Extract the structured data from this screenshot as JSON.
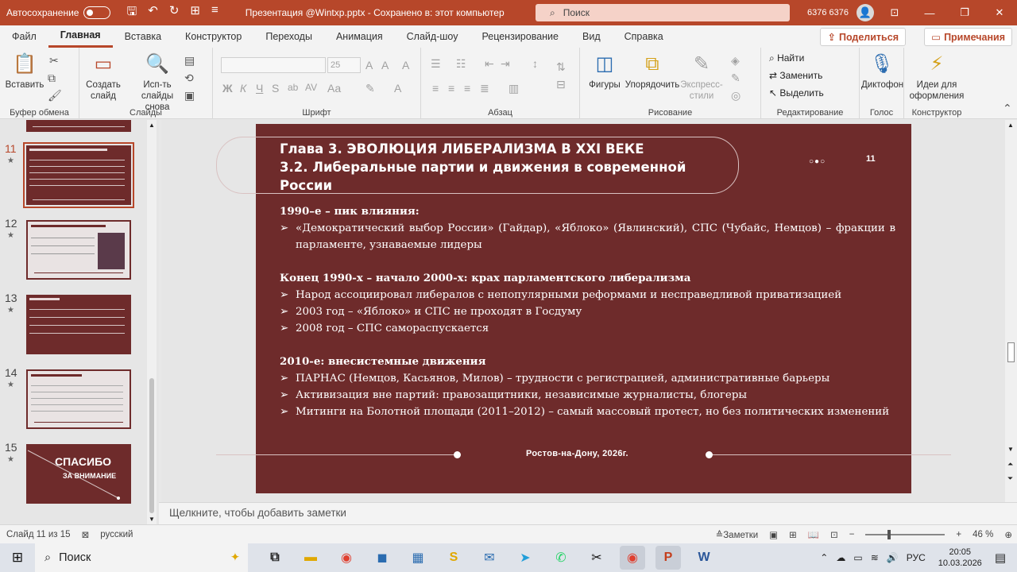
{
  "titlebar": {
    "autosave_label": "Автосохранение",
    "doc_title": "Презентация @Wintxp.pptx  -  Сохранено в: этот компьютер",
    "search_placeholder": "Поиск",
    "user_name": "6376 6376"
  },
  "menu": {
    "tabs": [
      "Файл",
      "Главная",
      "Вставка",
      "Конструктор",
      "Переходы",
      "Анимация",
      "Слайд-шоу",
      "Рецензирование",
      "Вид",
      "Справка"
    ],
    "share_label": "Поделиться",
    "comments_label": "Примечания"
  },
  "ribbon": {
    "clipboard": {
      "paste": "Вставить",
      "group": "Буфер обмена"
    },
    "slides": {
      "new_slide": "Создать слайд",
      "reuse": "Исп-ть слайды снова",
      "group": "Слайды"
    },
    "font": {
      "size": "25",
      "group": "Шрифт"
    },
    "paragraph": {
      "group": "Абзац"
    },
    "drawing": {
      "shapes": "Фигуры",
      "arrange": "Упорядочить",
      "styles": "Экспресс-стили",
      "group": "Рисование"
    },
    "editing": {
      "find": "Найти",
      "replace": "Заменить",
      "select": "Выделить",
      "group": "Редактирование"
    },
    "voice": {
      "dictate": "Диктофон",
      "group": "Голос"
    },
    "designer": {
      "ideas": "Идеи для оформления",
      "group": "Конструктор"
    }
  },
  "thumbnails": [
    {
      "num": "11",
      "selected": true
    },
    {
      "num": "12",
      "selected": false
    },
    {
      "num": "13",
      "selected": false
    },
    {
      "num": "14",
      "selected": false
    },
    {
      "num": "15",
      "selected": false,
      "text1": "СПАСИБО",
      "text2": "ЗА ВНИМАНИЕ"
    }
  ],
  "slide": {
    "title_line1": "Глава 3. ЭВОЛЮЦИЯ ЛИБЕРАЛИЗМА В XXI ВЕКЕ",
    "title_line2": "3.2. Либеральные партии и движения в современной России",
    "dots": "○●○",
    "page_number": "11",
    "section1_heading": "1990–е – пик влияния:",
    "section1_items": [
      "«Демократический выбор России» (Гайдар), «Яблоко» (Явлинский), СПС (Чубайс, Немцов) – фракции в парламенте, узнаваемые лидеры"
    ],
    "section2_heading": "Конец 1990-х – начало 2000-х: крах парламентского либерализма",
    "section2_items": [
      "Народ ассоциировал либералов с непопулярными реформами и несправедливой приватизацией",
      "2003 год – «Яблоко» и СПС не проходят в Госдуму",
      "2008 год – СПС самораспускается"
    ],
    "section3_heading": "2010-е: внесистемные движения",
    "section3_items": [
      "ПАРНАС (Немцов, Касьянов, Милов) – трудности с регистрацией, административные барьеры",
      "Активизация вне партий: правозащитники, независимые журналисты, блогеры",
      "Митинги на Болотной площади (2011–2012) – самый массовый протест, но без политических изменений"
    ],
    "footer": "Ростов-на-Дону, 2026г."
  },
  "notes_placeholder": "Щелкните, чтобы добавить заметки",
  "statusbar": {
    "slide_info": "Слайд 11 из 15",
    "language": "русский",
    "notes_btn": "Заметки",
    "zoom": "46 %"
  },
  "taskbar": {
    "search": "Поиск",
    "lang": "РУС",
    "time": "20:05",
    "date": "10.03.2026"
  }
}
